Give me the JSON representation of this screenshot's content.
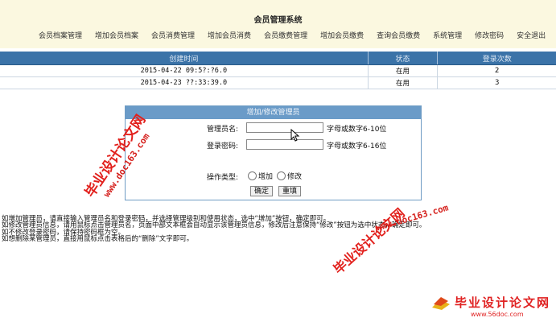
{
  "app": {
    "title": "会员管理系统"
  },
  "nav": [
    "会员档案管理",
    "增加会员档案",
    "会员消费管理",
    "增加会员消费",
    "会员缴费管理",
    "增加会员缴费",
    "查询会员缴费",
    "系统管理",
    "修改密码",
    "安全退出"
  ],
  "table": {
    "headers": [
      "创建时间",
      "状态",
      "登录次数"
    ],
    "rows": [
      {
        "time": "2015-04-22 09:5?:?6.0",
        "status": "在用",
        "count": "2"
      },
      {
        "time": "2015-04-23 ??:33:39.0",
        "status": "在用",
        "count": "3"
      }
    ]
  },
  "form": {
    "title": "增加/修改管理员",
    "username_label": "管理员名:",
    "username_value": "",
    "username_hint": "字母或数字6-10位",
    "password_label": "登录密码:",
    "password_value": "",
    "password_hint": "字母或数字6-16位",
    "optype_label": "操作类型:",
    "radio_add": "增加",
    "radio_edit": "修改",
    "submit_label": "确定",
    "reset_label": "重填"
  },
  "help": [
    "如增加管理员，请直接输入管理员名和登录密码，并选择管理级别和使用状态，选中“增加”按钮，确定即可。",
    "如修改管理员信息，请用鼠标点击管理员名，页面中部文本框会自动显示该管理员信息，修改后注意保持“修改”按钮为选中状态，确定即可。",
    "如不修改登录密码，请保持密码框为空。",
    "如想删除某管理员，直接用鼠标点击表格后的“删除”文字即可。"
  ],
  "watermark": {
    "cn": "毕业设计论文网",
    "url": "www.doc163.com",
    "logo_text": "毕业设计论文网",
    "logo_url": "www.56doc.com"
  },
  "colors": {
    "header_bg": "#fbf8e0",
    "table_head_bg": "#3b73a8",
    "panel_head_bg": "#6a9bc8",
    "watermark": "#e2201c"
  }
}
